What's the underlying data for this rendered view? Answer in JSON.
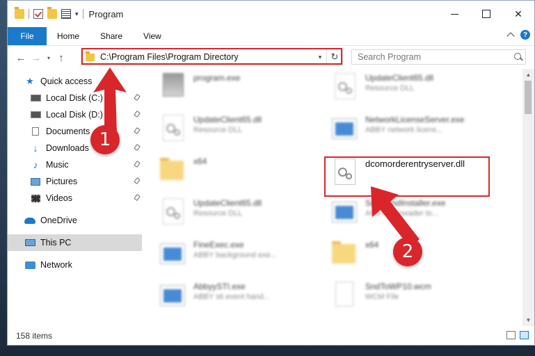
{
  "window": {
    "title": "Program"
  },
  "ribbon": {
    "file": "File",
    "tabs": [
      "Home",
      "Share",
      "View"
    ],
    "help": "?"
  },
  "address": {
    "path": "C:\\Program Files\\Program Directory"
  },
  "search": {
    "placeholder": "Search Program"
  },
  "nav": {
    "quick_access": "Quick access",
    "items": [
      "Local Disk (C:)",
      "Local Disk (D:)",
      "Documents",
      "Downloads",
      "Music",
      "Pictures",
      "Videos"
    ],
    "onedrive": "OneDrive",
    "thispc": "This PC",
    "network": "Network"
  },
  "files": {
    "f0": {
      "name": "program.exe",
      "desc": ""
    },
    "f1": {
      "name": "UpdateClient65.dll",
      "desc": "Resource DLL"
    },
    "f2": {
      "name": "UpdateClient65.dll",
      "desc": "Resource DLL"
    },
    "f3": {
      "name": "NetworkLicenseServer.exe",
      "desc": "ABBY network licens..."
    },
    "f4": {
      "name": "x64",
      "desc": ""
    },
    "f5": {
      "name": "dcomorderentryserver.dll",
      "desc": ""
    },
    "f6": {
      "name": "UpdateClient65.dll",
      "desc": "Resource DLL"
    },
    "f7": {
      "name": "ScrammdInstaller.exe",
      "desc": "ABBY fineseader to..."
    },
    "f8": {
      "name": "FineExec.exe",
      "desc": "ABBY background exe..."
    },
    "f9": {
      "name": "x64",
      "desc": ""
    },
    "f10": {
      "name": "AbbyySTI.exe",
      "desc": "ABBY sti event hand..."
    },
    "f11": {
      "name": "SndToWP10.wcm",
      "desc": "WCM File"
    }
  },
  "status": {
    "count": "158 items"
  },
  "badges": {
    "one": "1",
    "two": "2"
  },
  "colors": {
    "accent": "#1979ca",
    "highlight": "#d9262b"
  }
}
